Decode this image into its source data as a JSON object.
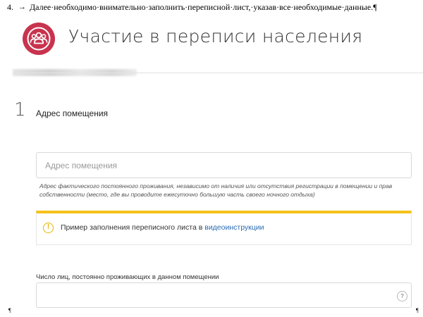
{
  "document": {
    "step_number": "4.",
    "arrow": "→",
    "instruction": "Далее·необходимо·внимательно·заполнить·переписной·лист,·указав·все·необходимые·данные.",
    "pilcrow": "¶"
  },
  "header": {
    "title": "Участие в переписи населения",
    "logo_icon": "people-group-icon",
    "brand_color": "#c8334e"
  },
  "section": {
    "number": "1",
    "title": "Адрес помещения"
  },
  "address": {
    "placeholder": "Адрес помещения",
    "value": "",
    "hint": "Адрес фактического постоянного проживания, независимо от наличия или отсутствия регистрации в помещении и прав собственности (место, где вы проводите ежесуточно большую часть своего ночного отдыха)"
  },
  "notice": {
    "icon": "exclamation-icon",
    "text": "Пример заполнения переписного листа в ",
    "link_text": "видеоинструкции",
    "accent_color": "#f5c21b",
    "link_color": "#2a6bb5"
  },
  "residents": {
    "label": "Число лиц, постоянно проживающих в данном помещении",
    "value": "",
    "help_label": "?"
  },
  "footer": {
    "left_mark": "¶",
    "right_mark": "¶"
  }
}
